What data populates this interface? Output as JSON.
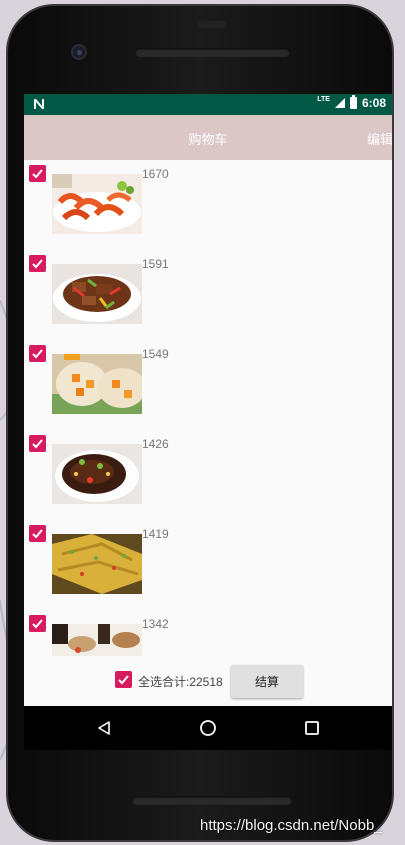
{
  "status_bar": {
    "network": "LTE",
    "time": "6:08"
  },
  "app_bar": {
    "title": "购物车",
    "edit_label": "编辑"
  },
  "cart": {
    "items": [
      {
        "count": "1670",
        "checked": true,
        "image": "shrimp-dish"
      },
      {
        "count": "1591",
        "checked": true,
        "image": "braised-pork-with-peppers"
      },
      {
        "count": "1549",
        "checked": true,
        "image": "mango-dessert"
      },
      {
        "count": "1426",
        "checked": true,
        "image": "braised-fish"
      },
      {
        "count": "1419",
        "checked": true,
        "image": "pan-fried-tofu"
      },
      {
        "count": "1342",
        "checked": true,
        "image": "assorted-dishes"
      }
    ]
  },
  "footer": {
    "select_all_checked": true,
    "total_label": "全选合计:22518",
    "checkout_label": "结算"
  },
  "watermark": "https://blog.csdn.net/Nobb_",
  "colors": {
    "status_bar": "#005845",
    "app_bar": "#dcc7c7",
    "accent": "#d81b60"
  }
}
